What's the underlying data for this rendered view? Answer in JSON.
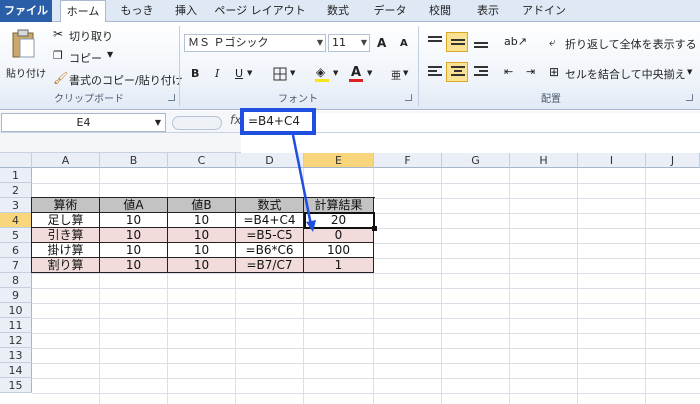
{
  "tabs": [
    "ファイル",
    "ホーム",
    "もっき",
    "挿入",
    "ページ レイアウト",
    "数式",
    "データ",
    "校閲",
    "表示",
    "アドイン"
  ],
  "clipboard": {
    "paste": "貼り付け",
    "cut": "切り取り",
    "copy": "コピー",
    "format_painter": "書式のコピー/貼り付け",
    "group_label": "クリップボード"
  },
  "font": {
    "name": "ＭＳ Ｐゴシック",
    "size": "11",
    "bold": "B",
    "italic": "I",
    "underline": "U",
    "color_letter": "A",
    "grow": "A",
    "shrink": "A",
    "group_label": "フォント"
  },
  "alignment": {
    "wrap_text": "折り返して全体を表示する",
    "merge_center": "セルを結合して中央揃え",
    "group_label": "配置"
  },
  "formula_bar": {
    "name_box": "E4",
    "fx": "fx",
    "formula": "=B4+C4"
  },
  "sheet": {
    "columns": [
      "A",
      "B",
      "C",
      "D",
      "E",
      "F",
      "G",
      "H",
      "I",
      "J"
    ],
    "rows": [
      "1",
      "2",
      "3",
      "4",
      "5",
      "6",
      "7",
      "8",
      "9",
      "10",
      "11",
      "12",
      "13",
      "14",
      "15"
    ],
    "selected_column": "E",
    "selected_row": "4",
    "table": {
      "headers": [
        "算術",
        "値A",
        "値B",
        "数式",
        "計算結果"
      ],
      "rows": [
        [
          "足し算",
          "10",
          "10",
          "=B4+C4",
          "20"
        ],
        [
          "引き算",
          "10",
          "10",
          "=B5-C5",
          "0"
        ],
        [
          "掛け算",
          "10",
          "10",
          "=B6*C6",
          "100"
        ],
        [
          "割り算",
          "10",
          "10",
          "=B7/C7",
          "1"
        ]
      ]
    }
  },
  "colors": {
    "accent": "#1f4fe0",
    "header_fill": "#c3c3c3",
    "pink_fill": "#f2dcdb",
    "selection": "#f9d67c"
  }
}
